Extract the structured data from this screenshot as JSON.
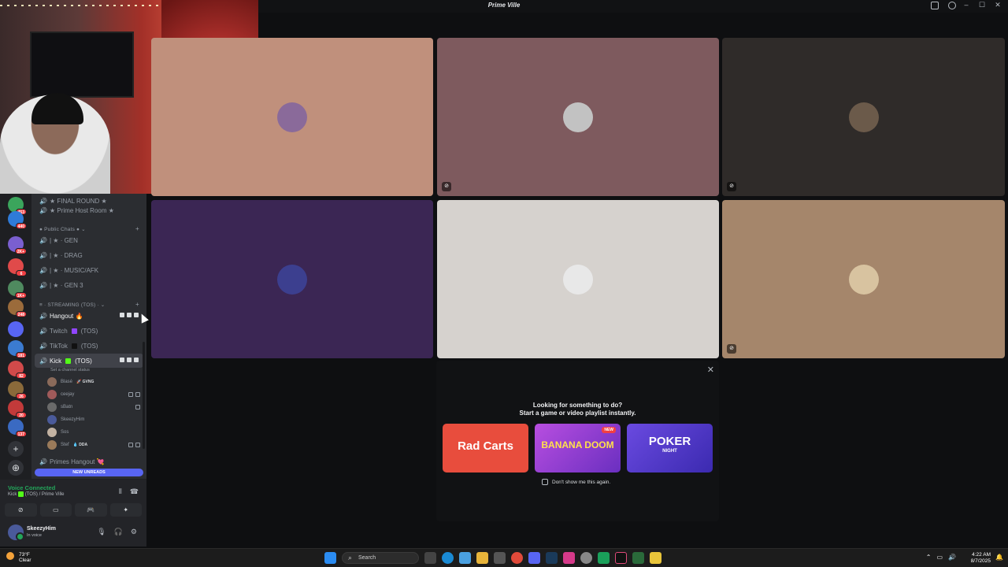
{
  "window": {
    "title": "Prime Ville"
  },
  "rail": {
    "servers": [
      {
        "badge": "453",
        "color": "#3ba55c"
      },
      {
        "badge": "440",
        "color": "#2f7bd8"
      },
      {
        "badge": "2K+",
        "color": "#7a5fcf"
      },
      {
        "badge": "6",
        "color": "#e04a4a"
      },
      {
        "badge": "1K+",
        "color": "#4f8a5f"
      },
      {
        "badge": "248",
        "color": "#9b6b3b"
      },
      {
        "badge": "",
        "color": "#5865f2"
      },
      {
        "badge": "181",
        "color": "#3b7bd1"
      },
      {
        "badge": "82",
        "color": "#d14a4a"
      },
      {
        "badge": "26",
        "color": "#8a6a3a"
      },
      {
        "badge": "20",
        "color": "#c23a3a"
      },
      {
        "badge": "137",
        "color": "#3a6ac2"
      }
    ]
  },
  "sidebar": {
    "channels_top": [
      {
        "label": "★ FINAL ROUND ★"
      },
      {
        "label": "★ Prime Host Room ★"
      }
    ],
    "cat_public": "Public Chats",
    "public": [
      {
        "label": "| ★ · GEN"
      },
      {
        "label": "| ★ · DRAG"
      },
      {
        "label": "| ★ · MUSIC/AFK"
      },
      {
        "label": "| ★ · GEN 3"
      }
    ],
    "cat_streaming": "STREAMING (TOS)",
    "streaming": [
      {
        "label": "Hangout 🔥"
      },
      {
        "label": "Twitch",
        "suffix": "(TOS)",
        "sq": "#9146ff"
      },
      {
        "label": "TikTok",
        "suffix": "(TOS)",
        "sq": "#111111"
      },
      {
        "label": "Kick",
        "suffix": "(TOS)",
        "sq": "#53fc18"
      }
    ],
    "channel_status": "Set a channel status",
    "voice_users": [
      {
        "name": "Blasé",
        "tag": "🚀 GVNG"
      },
      {
        "name": "ceejay",
        "tag": ""
      },
      {
        "name": "sBatn",
        "tag": ""
      },
      {
        "name": "SkeezyHim",
        "tag": ""
      },
      {
        "name": "Sos",
        "tag": ""
      },
      {
        "name": "Stef",
        "tag": "💧 DDA"
      }
    ],
    "primes_hangout": "Primes Hangout 💘",
    "new_unreads": "NEW UNREADS"
  },
  "voice_panel": {
    "status": "Voice Connected",
    "channel": "Kick",
    "suffix": "(TOS) / Prime Ville"
  },
  "user_panel": {
    "name": "SkeezyHim",
    "status": "In voice"
  },
  "video_tiles": [
    {
      "bg": "#c0907c",
      "avatar": "#8a6a9a",
      "icon": ""
    },
    {
      "bg": "#7e5a5e",
      "avatar": "#c2c2c2",
      "icon": "⊘"
    },
    {
      "bg": "#2f2b29",
      "avatar": "#6b5a4a",
      "icon": "⊘"
    },
    {
      "bg": "#3b2654",
      "avatar": "#3c3f8f",
      "icon": ""
    },
    {
      "bg": "#d6d2ce",
      "avatar": "#e8e8e8",
      "icon": ""
    },
    {
      "bg": "#a5866b",
      "avatar": "#d8c3a0",
      "icon": "⊘"
    }
  ],
  "activity": {
    "line1": "Looking for something to do?",
    "line2": "Start a game or video playlist instantly.",
    "cards": [
      {
        "title": "Rad Carts",
        "bg": "#e84d3d"
      },
      {
        "title": "BANANA DOOM",
        "bg": "#9b3ed6",
        "badge": "NEW"
      },
      {
        "title": "POKER",
        "sub": "NIGHT",
        "bg": "#5a3fd6"
      }
    ],
    "dont_show": "Don't show me this again."
  },
  "taskbar": {
    "temp": "73°F",
    "weather": "Clear",
    "search": "Search",
    "time": "4:22 AM",
    "date": "8/7/2025"
  }
}
